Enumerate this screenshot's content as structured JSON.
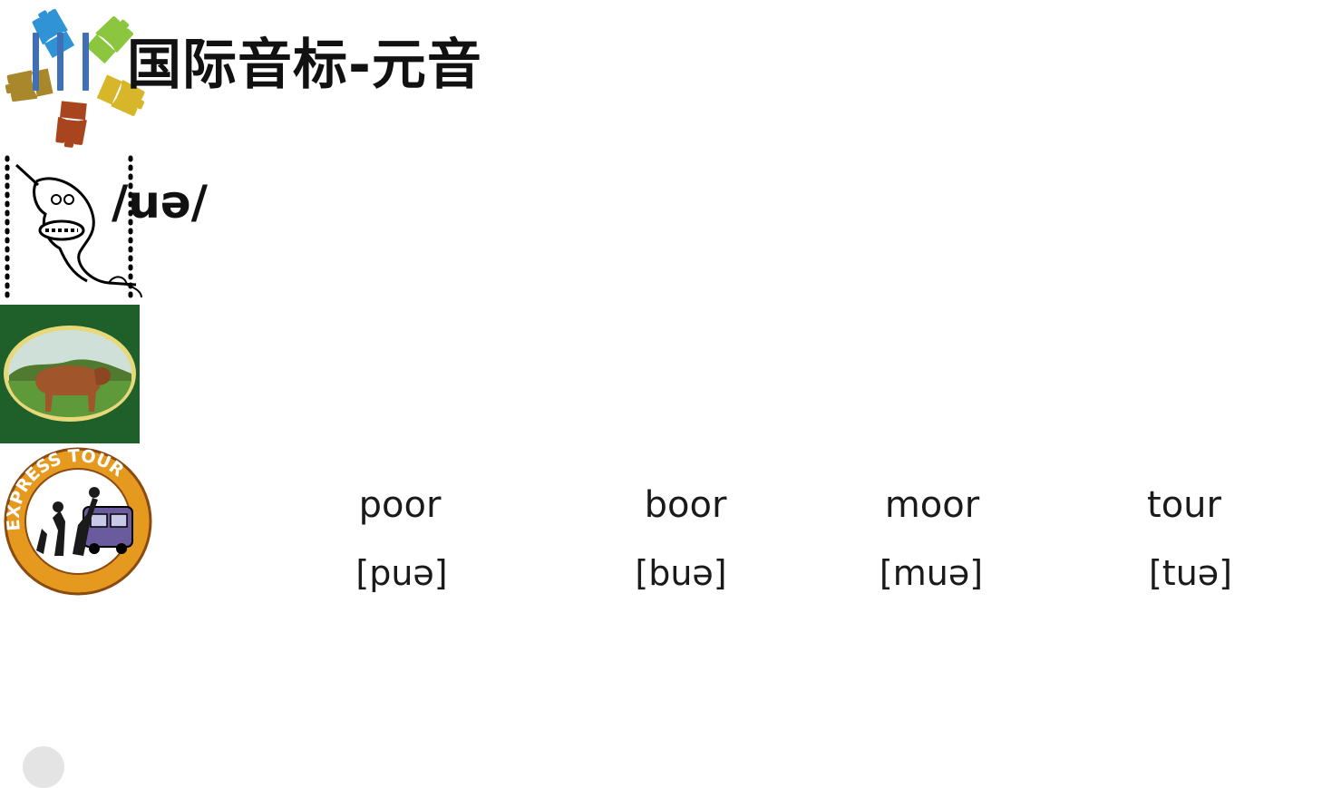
{
  "header": {
    "title": "国际音标-元音",
    "accent_color": "#3f6fb5"
  },
  "phoneme": "/uə/",
  "words": [
    {
      "word": "poor",
      "ipa": "[puə]",
      "image": "colorful-hands-icon"
    },
    {
      "word": "boor",
      "ipa": "[buə]",
      "image": "drill-cartoon-icon"
    },
    {
      "word": "moor",
      "ipa": "[muə]",
      "image": "cow-on-moor-icon"
    },
    {
      "word": "tour",
      "ipa": "[tuə]",
      "image": "express-tour-logo"
    }
  ],
  "logo_text": "EXPRESS TOUR"
}
